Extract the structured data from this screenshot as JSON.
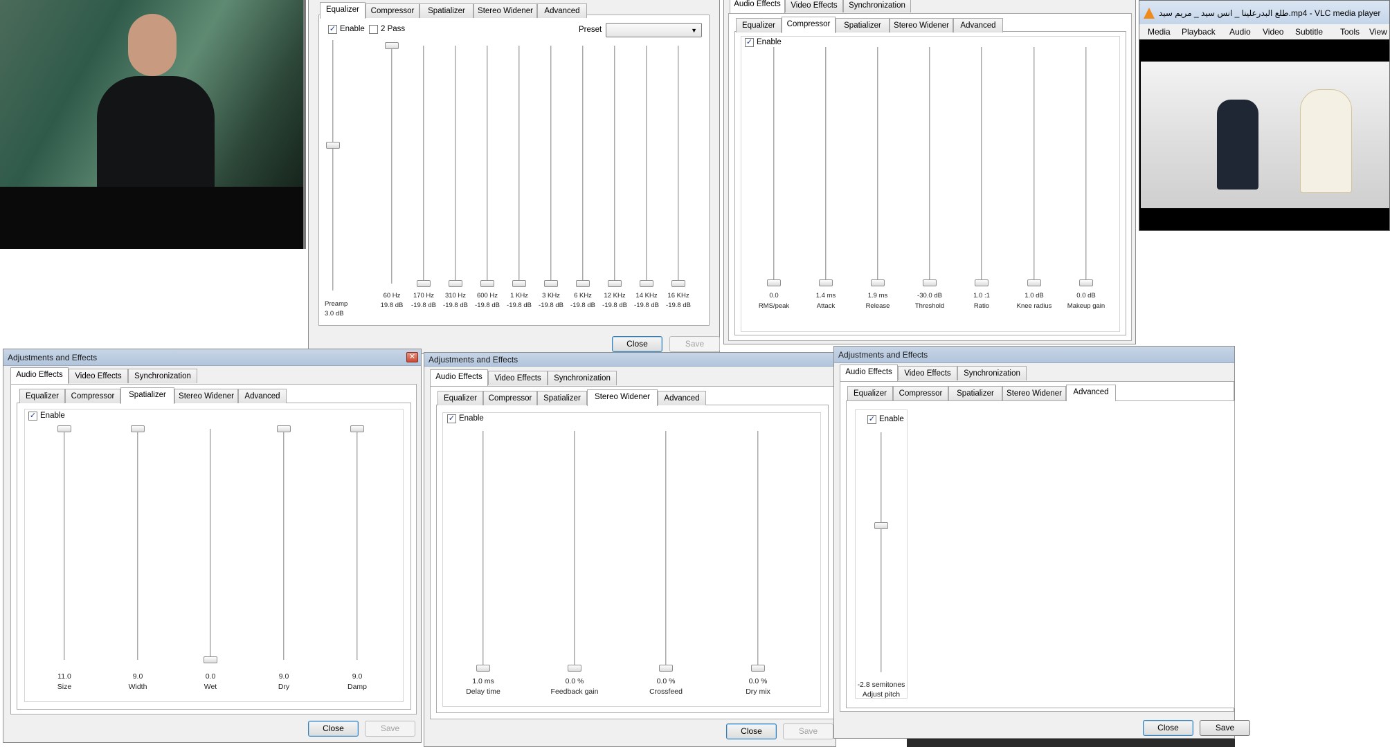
{
  "vlc": {
    "window_title": "طلع البدرعلينا _ انس سيد _ مريم سيد.mp4 - VLC media player",
    "menu": [
      "Media",
      "Playback",
      "Audio",
      "Video",
      "Subtitle",
      "Tools",
      "View"
    ]
  },
  "dialog_title": "Adjustments and Effects",
  "main_tabs": [
    "Audio Effects",
    "Video Effects",
    "Synchronization"
  ],
  "audio_tabs": [
    "Equalizer",
    "Compressor",
    "Spatializer",
    "Stereo Widener",
    "Advanced"
  ],
  "buttons": {
    "close": "Close",
    "save": "Save"
  },
  "enable_label": "Enable",
  "equalizer": {
    "two_pass_label": "2 Pass",
    "preset_label": "Preset",
    "preset_value": "",
    "preamp": {
      "name": "Preamp",
      "value": "3.0 dB",
      "level": 0.58
    },
    "bands": [
      {
        "freq": "60 Hz",
        "value": "19.8 dB",
        "level": 1.0
      },
      {
        "freq": "170 Hz",
        "value": "-19.8 dB",
        "level": 0.0
      },
      {
        "freq": "310 Hz",
        "value": "-19.8 dB",
        "level": 0.0
      },
      {
        "freq": "600 Hz",
        "value": "-19.8 dB",
        "level": 0.0
      },
      {
        "freq": "1 KHz",
        "value": "-19.8 dB",
        "level": 0.0
      },
      {
        "freq": "3 KHz",
        "value": "-19.8 dB",
        "level": 0.0
      },
      {
        "freq": "6 KHz",
        "value": "-19.8 dB",
        "level": 0.0
      },
      {
        "freq": "12 KHz",
        "value": "-19.8 dB",
        "level": 0.0
      },
      {
        "freq": "14 KHz",
        "value": "-19.8 dB",
        "level": 0.0
      },
      {
        "freq": "16 KHz",
        "value": "-19.8 dB",
        "level": 0.0
      }
    ]
  },
  "compressor": {
    "sliders": [
      {
        "value": "0.0",
        "name": "RMS/peak",
        "level": 0.0
      },
      {
        "value": "1.4 ms",
        "name": "Attack",
        "level": 0.0
      },
      {
        "value": "1.9 ms",
        "name": "Release",
        "level": 0.0
      },
      {
        "value": "-30.0 dB",
        "name": "Threshold",
        "level": 0.0
      },
      {
        "value": "1.0 :1",
        "name": "Ratio",
        "level": 0.0
      },
      {
        "value": "1.0 dB",
        "name": "Knee radius",
        "level": 0.0
      },
      {
        "value": "0.0 dB",
        "name": "Makeup gain",
        "level": 0.0
      }
    ]
  },
  "spatializer": {
    "sliders": [
      {
        "value": "11.0",
        "name": "Size",
        "level": 1.0
      },
      {
        "value": "9.0",
        "name": "Width",
        "level": 1.0
      },
      {
        "value": "0.0",
        "name": "Wet",
        "level": 0.0
      },
      {
        "value": "9.0",
        "name": "Dry",
        "level": 1.0
      },
      {
        "value": "9.0",
        "name": "Damp",
        "level": 1.0
      }
    ]
  },
  "stereo_widener": {
    "sliders": [
      {
        "value": "1.0 ms",
        "name": "Delay time",
        "level": 0.0
      },
      {
        "value": "0.0 %",
        "name": "Feedback gain",
        "level": 0.0
      },
      {
        "value": "0.0 %",
        "name": "Crossfeed",
        "level": 0.0
      },
      {
        "value": "0.0 %",
        "name": "Dry mix",
        "level": 0.0
      }
    ]
  },
  "advanced": {
    "pitch_value": "-2.8 semitones",
    "pitch_label": "Adjust pitch",
    "level": 0.61
  }
}
